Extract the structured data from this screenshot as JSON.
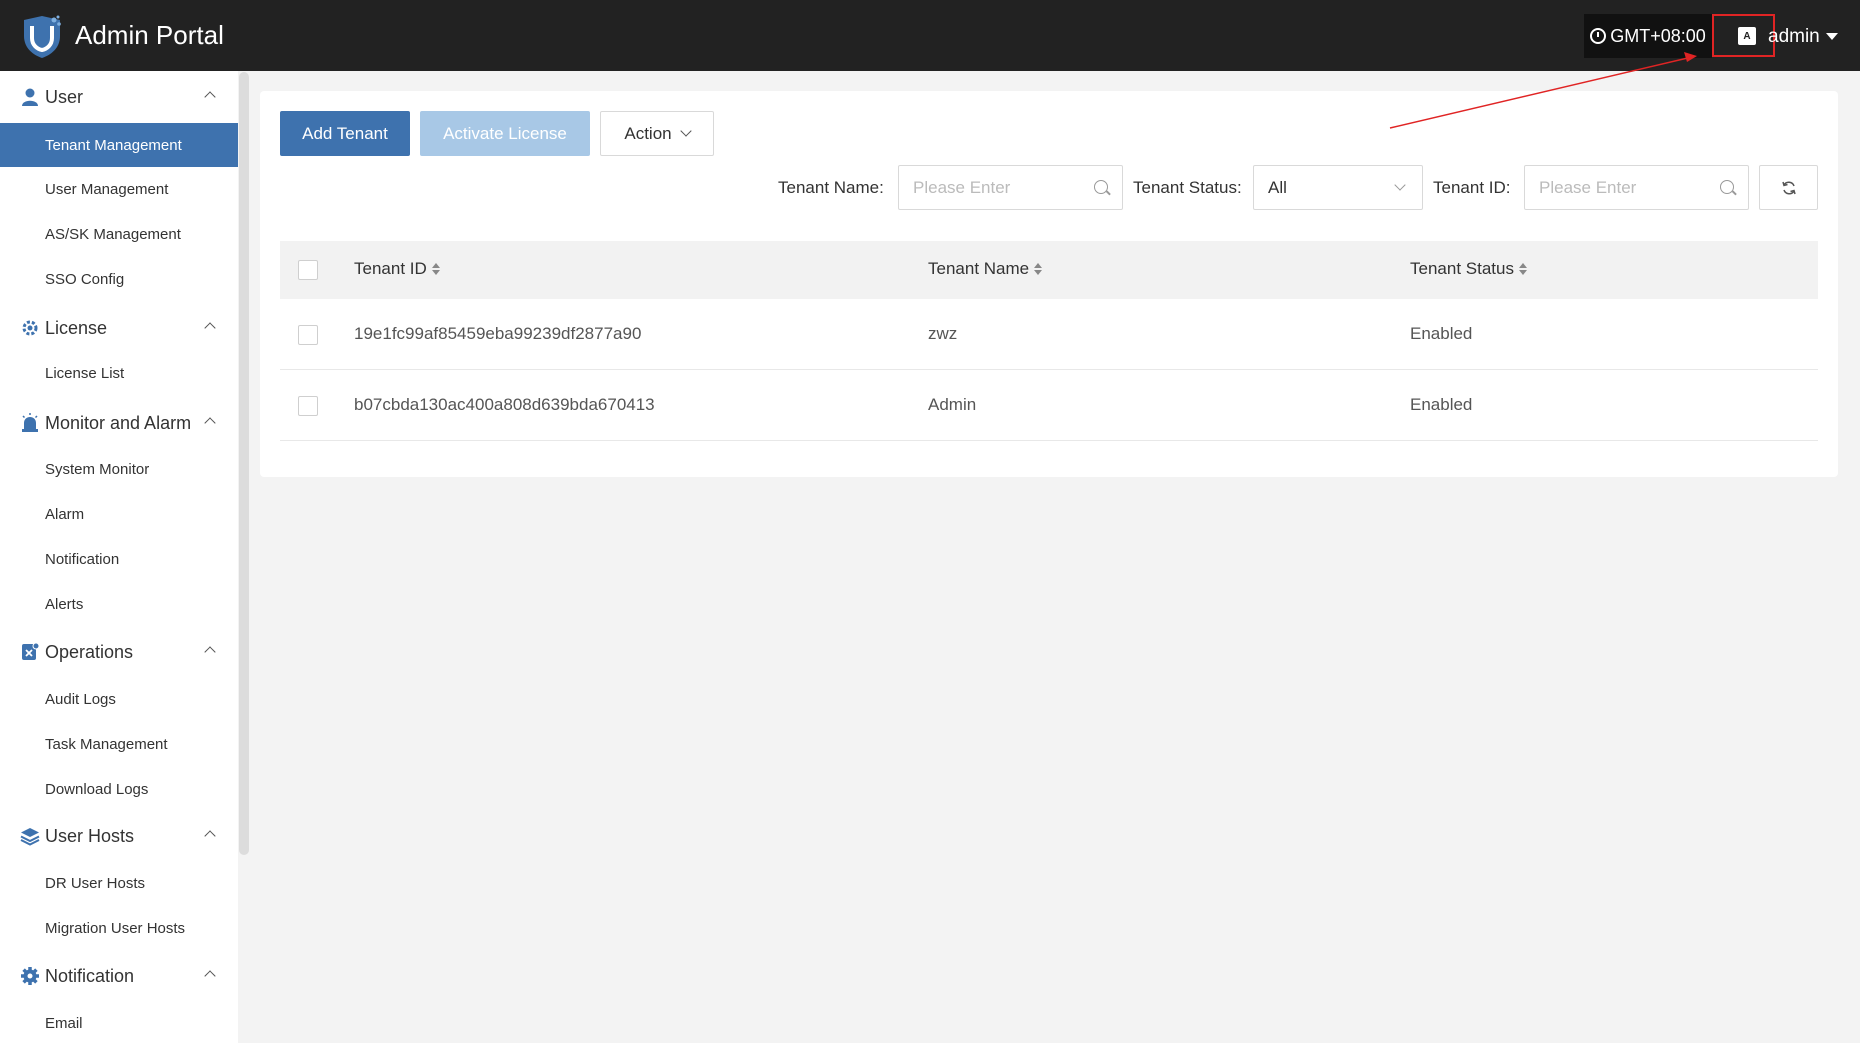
{
  "header": {
    "app_title": "Admin Portal",
    "timezone": "GMT+08:00",
    "lang_icon_glyph": "A",
    "user": "admin"
  },
  "sidebar": {
    "groups": [
      {
        "label": "User",
        "icon": "user-icon",
        "items": [
          "Tenant Management",
          "User Management",
          "AS/SK Management",
          "SSO Config"
        ]
      },
      {
        "label": "License",
        "icon": "license-gear-icon",
        "items": [
          "License List"
        ]
      },
      {
        "label": "Monitor and Alarm",
        "icon": "alarm-icon",
        "items": [
          "System Monitor",
          "Alarm",
          "Notification",
          "Alerts"
        ]
      },
      {
        "label": "Operations",
        "icon": "operations-icon",
        "items": [
          "Audit Logs",
          "Task Management",
          "Download Logs"
        ]
      },
      {
        "label": "User Hosts",
        "icon": "layers-icon",
        "items": [
          "DR User Hosts",
          "Migration User Hosts"
        ]
      },
      {
        "label": "Notification",
        "icon": "gear-icon",
        "items": [
          "Email"
        ]
      }
    ],
    "active_item": "Tenant Management"
  },
  "toolbar": {
    "add_tenant": "Add Tenant",
    "activate_license": "Activate License",
    "action": "Action"
  },
  "filters": {
    "tenant_name_label": "Tenant Name:",
    "tenant_name_placeholder": "Please Enter",
    "tenant_status_label": "Tenant Status:",
    "tenant_status_value": "All",
    "tenant_id_label": "Tenant ID:",
    "tenant_id_placeholder": "Please Enter"
  },
  "table": {
    "columns": [
      "Tenant ID",
      "Tenant Name",
      "Tenant Status"
    ],
    "rows": [
      {
        "id": "19e1fc99af85459eba99239df2877a90",
        "name": "zwz",
        "status": "Enabled"
      },
      {
        "id": "b07cbda130ac400a808d639bda670413",
        "name": "Admin",
        "status": "Enabled"
      }
    ]
  },
  "colors": {
    "header_bg": "#222222",
    "primary": "#3e72ae",
    "primary_disabled": "#a8c8e6",
    "annotation": "#e02424"
  }
}
